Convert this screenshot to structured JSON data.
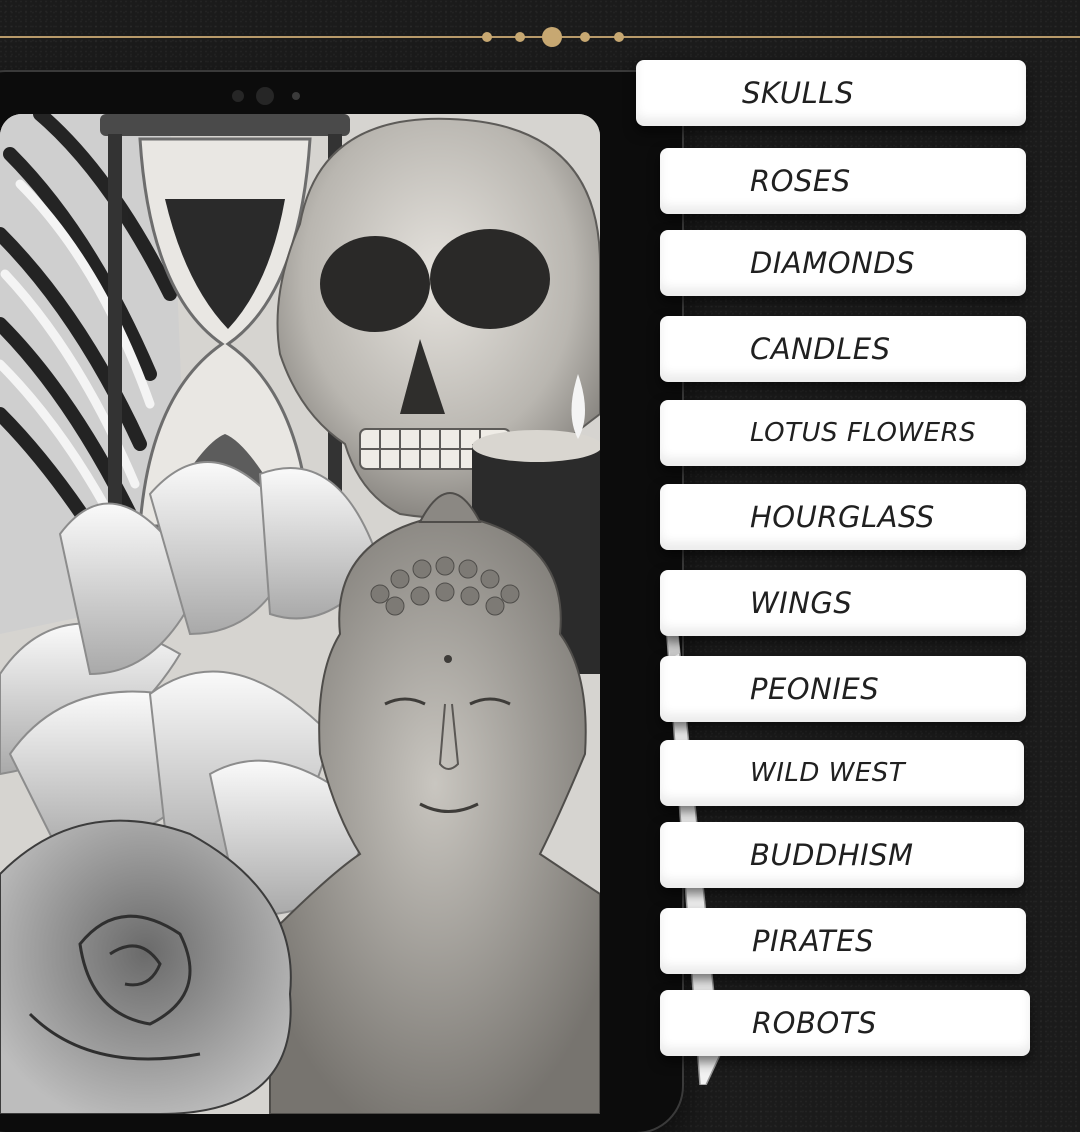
{
  "categories": [
    {
      "label": "SKULLS"
    },
    {
      "label": "ROSES"
    },
    {
      "label": "DIAMONDS"
    },
    {
      "label": "CANDLES"
    },
    {
      "label": "LOTUS FLOWERS"
    },
    {
      "label": "HOURGLASS"
    },
    {
      "label": "WINGS"
    },
    {
      "label": "PEONIES"
    },
    {
      "label": "WILD WEST"
    },
    {
      "label": "BUDDHISM"
    },
    {
      "label": "PIRATES"
    },
    {
      "label": "ROBOTS"
    }
  ],
  "colors": {
    "background": "#1b1b1b",
    "accent_gold": "#c7a872",
    "tab": "#ffffff",
    "tab_text": "#202020",
    "tablet_frame": "#0c0c0c"
  },
  "icons": [
    "camera-icon",
    "stylus-pencil"
  ]
}
